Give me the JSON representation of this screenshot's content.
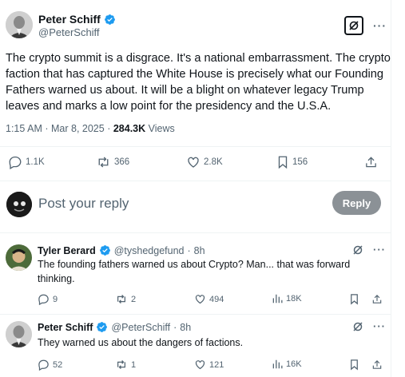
{
  "main_tweet": {
    "author_name": "Peter Schiff",
    "author_handle": "@PeterSchiff",
    "text": "The crypto summit is a disgrace. It's a national embarrassment. The crypto faction that has captured the White House is precisely what our Founding Fathers warned us about. It will be a blight on whatever legacy Trump leaves and marks a low point for the presidency and the U.S.A.",
    "time": "1:15 AM",
    "date": "Mar 8, 2025",
    "views_count": "284.3K",
    "views_label": "Views",
    "stats": {
      "replies": "1.1K",
      "reposts": "366",
      "likes": "2.8K",
      "bookmarks": "156"
    }
  },
  "composer": {
    "placeholder": "Post your reply",
    "reply_button": "Reply"
  },
  "replies": [
    {
      "author_name": "Tyler Berard",
      "author_handle": "@tyshedgefund",
      "age": "8h",
      "text": "The founding fathers warned us about Crypto? Man... that was forward thinking.",
      "stats": {
        "replies": "9",
        "reposts": "2",
        "likes": "494",
        "views": "18K"
      }
    },
    {
      "author_name": "Peter Schiff",
      "author_handle": "@PeterSchiff",
      "age": "8h",
      "text": "They warned us about the dangers of factions.",
      "stats": {
        "replies": "52",
        "reposts": "1",
        "likes": "121",
        "views": "16K"
      }
    }
  ],
  "colors": {
    "verified": "#1d9bf0",
    "secondary_text": "#536471",
    "primary_text": "#0f1419",
    "reply_button_bg": "#8b9196"
  }
}
